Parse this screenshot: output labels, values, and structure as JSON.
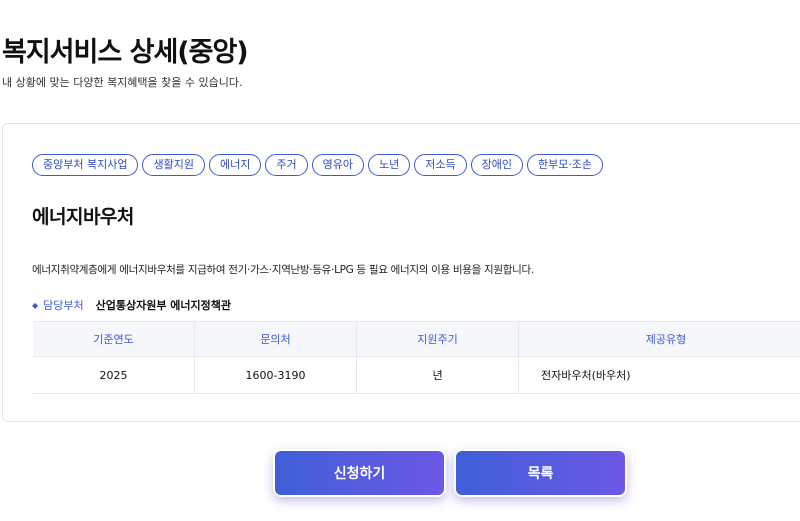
{
  "page": {
    "title": "복지서비스 상세(중앙)",
    "subtitle": "내 상황에 맞는 다양한 복지혜택을 찾을 수 있습니다."
  },
  "tags": [
    "중앙부처 복지사업",
    "생활지원",
    "에너지",
    "주거",
    "영유아",
    "노년",
    "저소득",
    "장애인",
    "한부모·조손"
  ],
  "service": {
    "title": "에너지바우처",
    "description": "에너지취약계층에게 에너지바우처를 지급하여 전기·가스·지역난방·등유·LPG 등 필요 에너지의 이용 비용을 지원합니다.",
    "department_label": "담당부처",
    "department_value": "산업통상자원부 에너지정책관"
  },
  "table": {
    "headers": [
      "기준연도",
      "문의처",
      "지원주기",
      "제공유형"
    ],
    "rows": [
      [
        "2025",
        "1600-3190",
        "년",
        "전자바우처(바우처)"
      ]
    ]
  },
  "buttons": {
    "apply": "신청하기",
    "list": "목록"
  },
  "colors": {
    "accent": "#3d5bd6",
    "button_gradient_start": "#3f5fd8",
    "button_gradient_end": "#6c58e6"
  }
}
